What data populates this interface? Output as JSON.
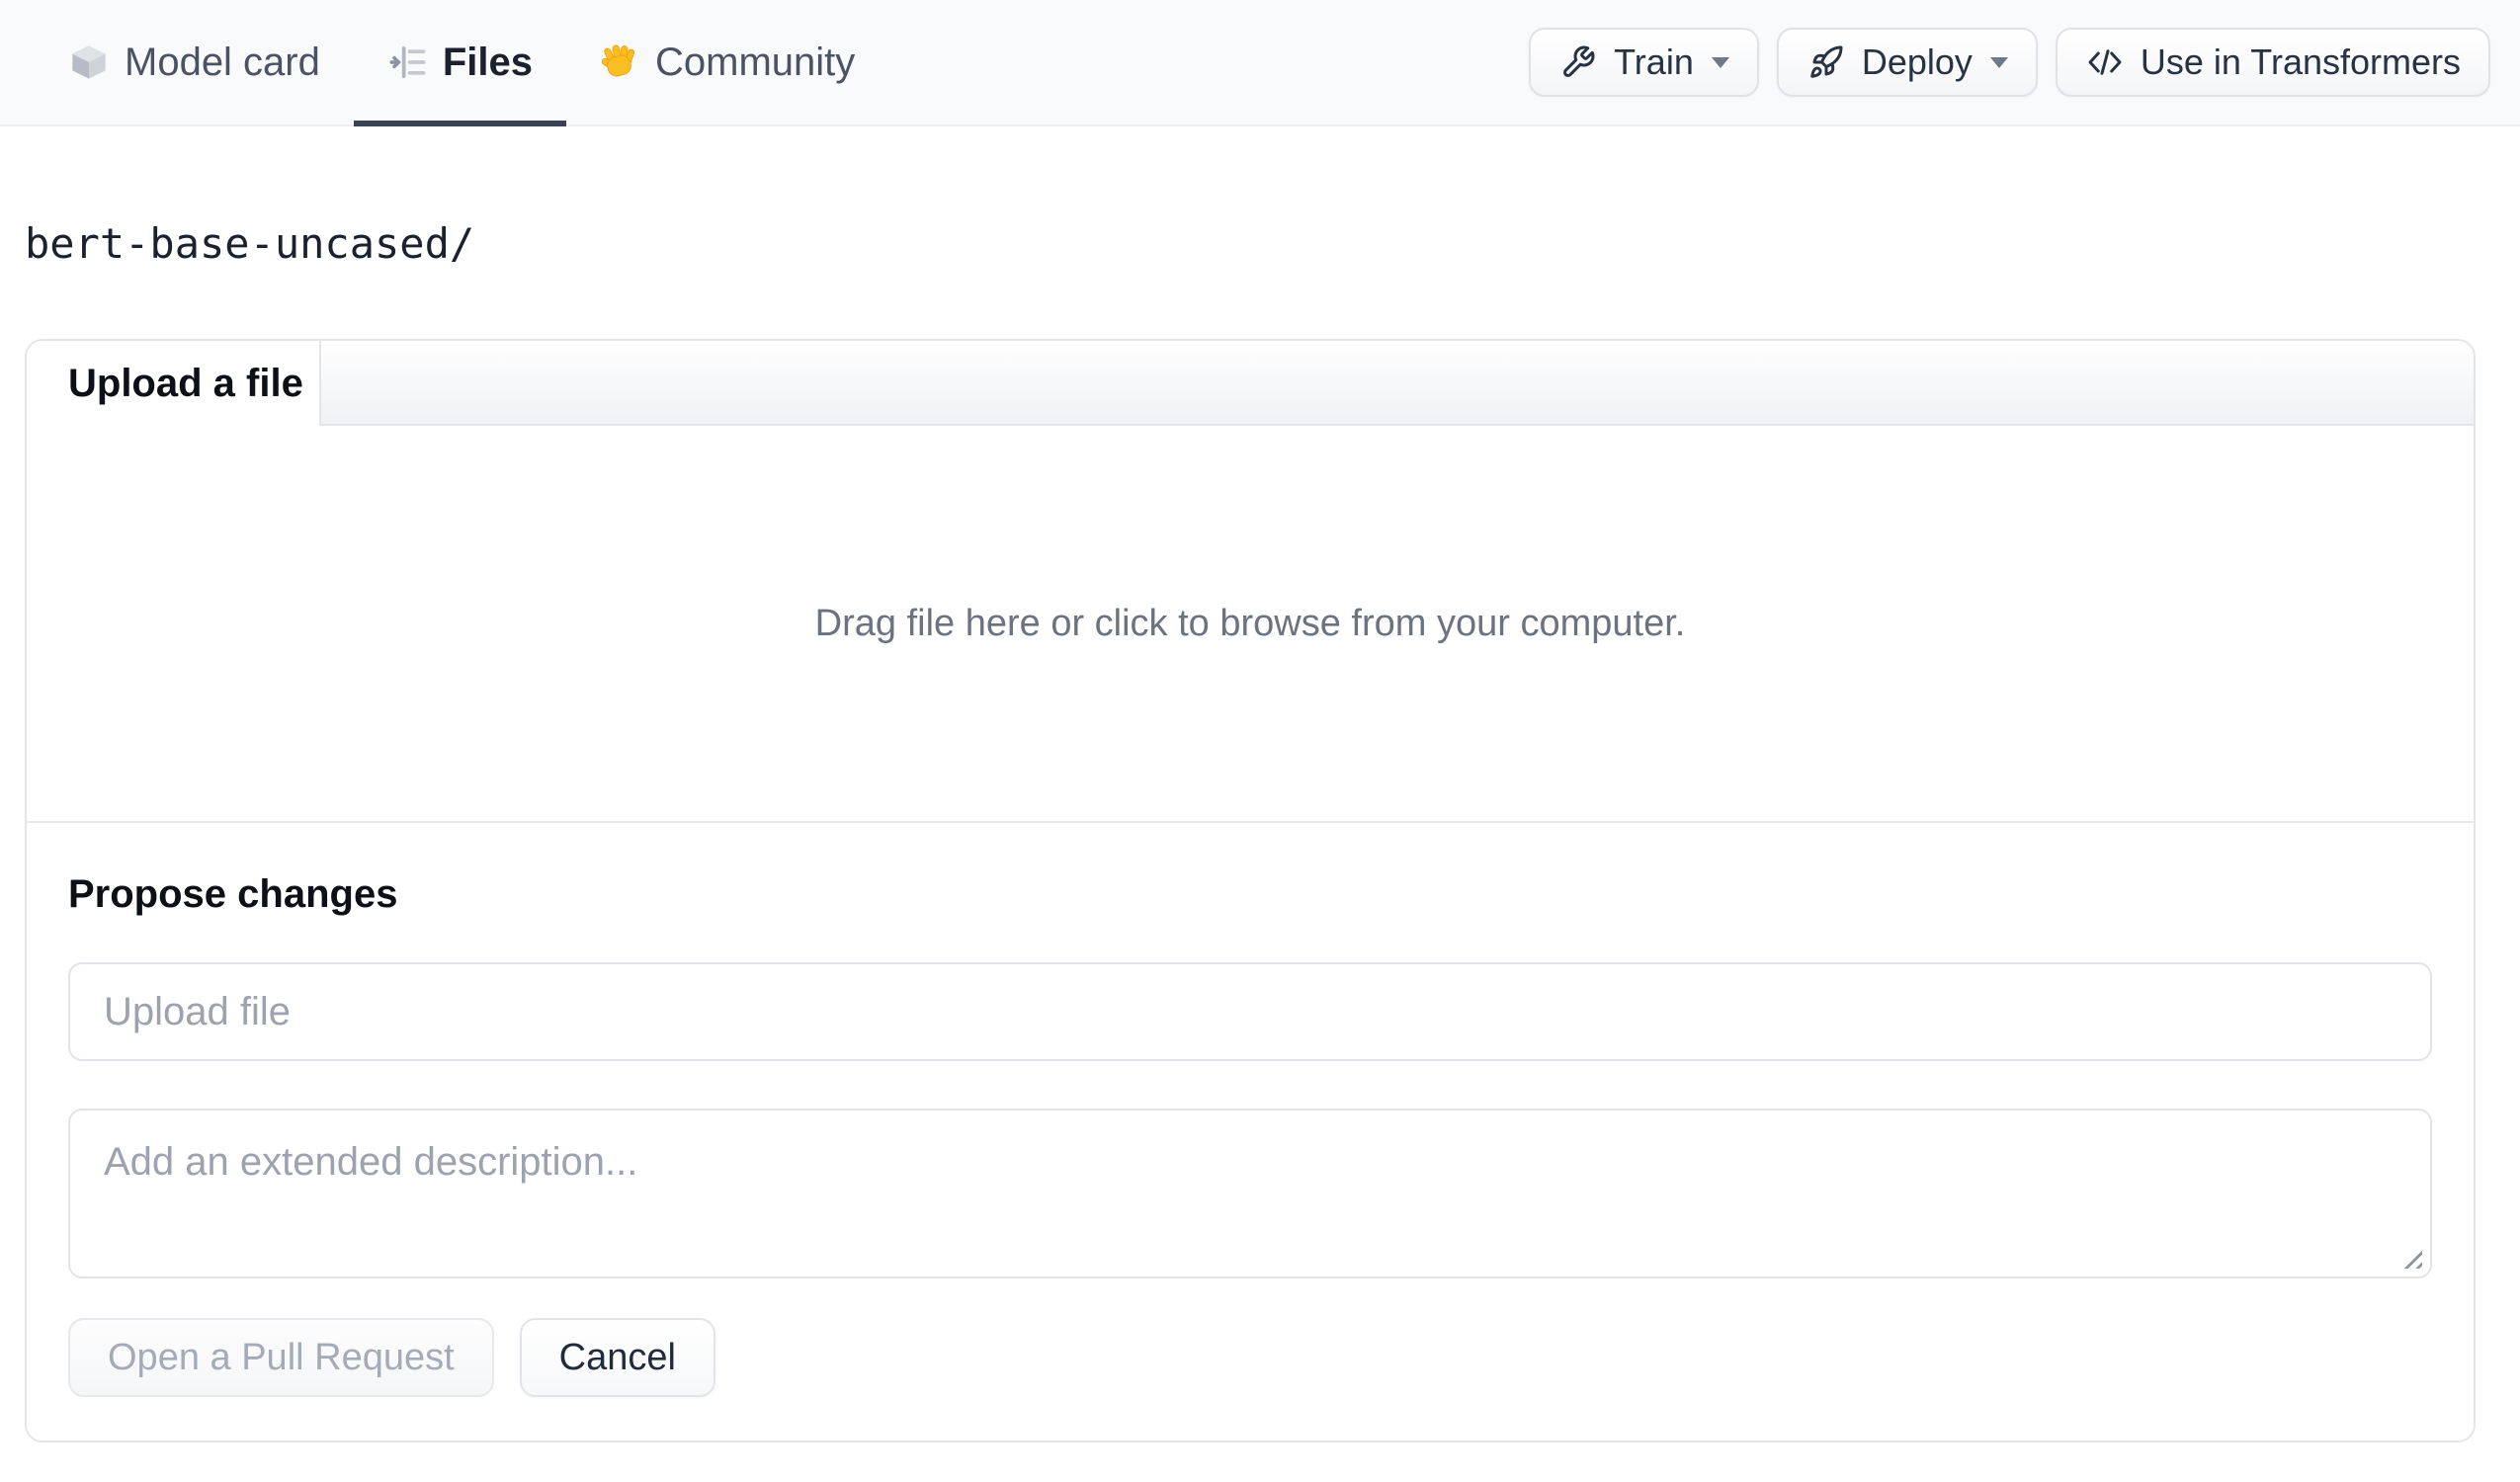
{
  "nav": {
    "tabs": [
      {
        "label": "Model card",
        "icon": "cube-icon",
        "active": false
      },
      {
        "label": "Files",
        "icon": "files-icon",
        "active": true
      },
      {
        "label": "Community",
        "icon": "wave-icon",
        "active": false
      }
    ],
    "actions": [
      {
        "label": "Train",
        "icon": "wrench-icon",
        "has_dropdown": true
      },
      {
        "label": "Deploy",
        "icon": "rocket-icon",
        "has_dropdown": true
      },
      {
        "label": "Use in Transformers",
        "icon": "code-icon",
        "has_dropdown": false
      }
    ]
  },
  "breadcrumb": {
    "path": "bert-base-uncased/"
  },
  "upload_panel": {
    "active_tab": "Upload a file",
    "dropzone_text": "Drag file here or click to browse from your computer.",
    "propose_heading": "Propose changes",
    "file_input_placeholder": "Upload file",
    "description_placeholder": "Add an extended description...",
    "open_pr_label": "Open a Pull Request",
    "open_pr_disabled": true,
    "cancel_label": "Cancel"
  },
  "colors": {
    "nav_background": "#f9fafb",
    "active_tab_underline": "#384252",
    "active_tab_text": "#1a202c",
    "inactive_tab_text": "#4a5263",
    "dropzone_text": "#6b7280",
    "placeholder_text": "#9ca3af",
    "panel_border": "#e3e5ea",
    "disabled_button_text": "#a4abb7",
    "wave_emoji_yellow": "#fbbf24"
  }
}
